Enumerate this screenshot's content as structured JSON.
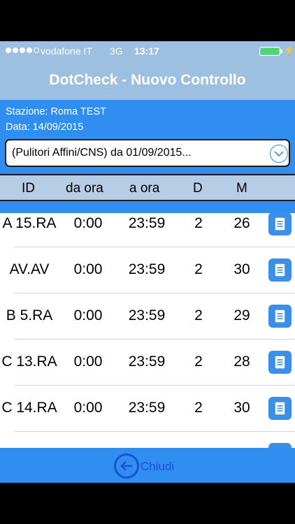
{
  "status_bar": {
    "carrier": "vodafone IT",
    "network": "3G",
    "time": "13:17",
    "charging_symbol": "⚡",
    "signal_dots": 4
  },
  "nav": {
    "title": "DotCheck - Nuovo Controllo"
  },
  "info": {
    "station": "Stazione: Roma TEST",
    "date": "Data: 14/09/2015",
    "selector_value": "(Pulitori Affini/CNS) da 01/09/2015..."
  },
  "table": {
    "headers": {
      "id": "ID",
      "from": "da ora",
      "to": "a ora",
      "d": "D",
      "m": "M"
    },
    "rows": [
      {
        "id": "A 15.RA",
        "from": "0:00",
        "to": "23:59",
        "d": "2",
        "m": "26"
      },
      {
        "id": "AV.AV",
        "from": "0:00",
        "to": "23:59",
        "d": "2",
        "m": "30"
      },
      {
        "id": "B 5.RA",
        "from": "0:00",
        "to": "23:59",
        "d": "2",
        "m": "29"
      },
      {
        "id": "C 13.RA",
        "from": "0:00",
        "to": "23:59",
        "d": "2",
        "m": "28"
      },
      {
        "id": "C 14.RA",
        "from": "0:00",
        "to": "23:59",
        "d": "2",
        "m": "30"
      }
    ]
  },
  "toolbar": {
    "close_label": "Chiudi"
  },
  "colors": {
    "nav_bg": "#9dbfe0",
    "accent": "#2f8ef0",
    "header_bg": "#b7cde6",
    "doc_button": "#3a8fe8",
    "back_icon": "#1c4fd6",
    "battery": "#4cd964"
  }
}
